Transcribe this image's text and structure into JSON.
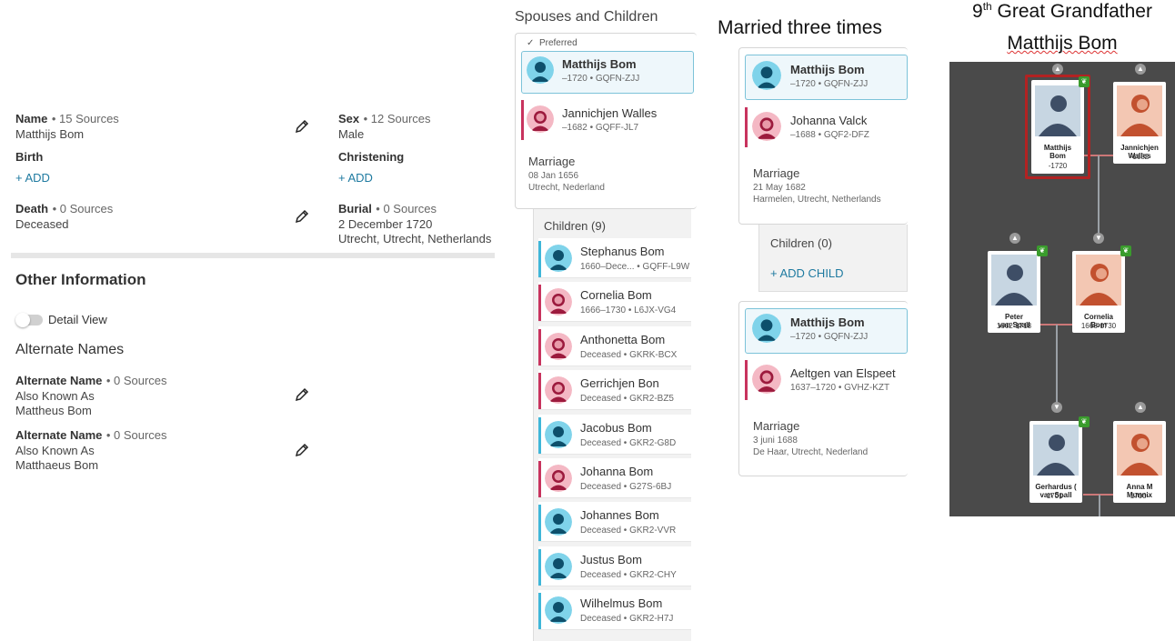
{
  "details": {
    "name": {
      "label": "Name",
      "sources": "• 15 Sources",
      "value": "Matthijs Bom"
    },
    "sex": {
      "label": "Sex",
      "sources": "• 12 Sources",
      "value": "Male"
    },
    "birth": {
      "label": "Birth",
      "add": "+  ADD"
    },
    "christening": {
      "label": "Christening",
      "add": "+  ADD"
    },
    "death": {
      "label": "Death",
      "sources": "• 0 Sources",
      "value": "Deceased"
    },
    "burial": {
      "label": "Burial",
      "sources": "• 0 Sources",
      "date": "2 December 1720",
      "place": "Utrecht, Utrecht, Netherlands"
    }
  },
  "other": {
    "heading": "Other Information",
    "detail_view": "Detail View",
    "alt_heading": "Alternate Names",
    "alt": [
      {
        "label": "Alternate Name",
        "sources": "• 0 Sources",
        "type": "Also Known As",
        "value": "Mattheus Bom"
      },
      {
        "label": "Alternate Name",
        "sources": "• 0 Sources",
        "type": "Also Known As",
        "value": "Matthaeus Bom"
      }
    ]
  },
  "family": {
    "title": "Spouses and Children",
    "preferred": "Preferred",
    "husband": {
      "name": "Matthijs Bom",
      "meta": "–1720 •  GQFN-ZJJ"
    },
    "wife": {
      "name": "Jannichjen Walles",
      "meta": "–1682 •  GQFF-JL7"
    },
    "marriage": {
      "label": "Marriage",
      "date": "08 Jan 1656",
      "place": "Utrecht, Nederland"
    },
    "children_header": "Children (9)",
    "children": [
      {
        "name": "Stephanus Bom",
        "meta": "1660–Dece...  •  GQFF-L9W",
        "sex": "m"
      },
      {
        "name": "Cornelia Bom",
        "meta": "1666–1730 •  L6JX-VG4",
        "sex": "f"
      },
      {
        "name": "Anthonetta Bom",
        "meta": "Deceased •  GKRK-BCX",
        "sex": "f"
      },
      {
        "name": "Gerrichjen Bon",
        "meta": "Deceased •  GKR2-BZ5",
        "sex": "f"
      },
      {
        "name": "Jacobus Bom",
        "meta": "Deceased •  GKR2-G8D",
        "sex": "m"
      },
      {
        "name": "Johanna Bom",
        "meta": "Deceased •  G27S-6BJ",
        "sex": "f"
      },
      {
        "name": "Johannes Bom",
        "meta": "Deceased •  GKR2-VVR",
        "sex": "m"
      },
      {
        "name": "Justus Bom",
        "meta": "Deceased •  GKR2-CHY",
        "sex": "m"
      },
      {
        "name": "Wilhelmus Bom",
        "meta": "Deceased •  GKR2-H7J",
        "sex": "m"
      }
    ]
  },
  "married": {
    "title": "Married three times",
    "m2": {
      "husband": {
        "name": "Matthijs Bom",
        "meta": "–1720 •  GQFN-ZJJ"
      },
      "wife": {
        "name": "Johanna Valck",
        "meta": "–1688 •  GQF2-DFZ"
      },
      "label": "Marriage",
      "date": "21 May 1682",
      "place": "Harmelen, Utrecht, Netherlands",
      "children_header": "Children (0)",
      "add_child": "+  ADD CHILD"
    },
    "m3": {
      "husband": {
        "name": "Matthijs Bom",
        "meta": "–1720 •  GQFN-ZJJ"
      },
      "wife": {
        "name": "Aeltgen van Elspeet",
        "meta": "1637–1720 •  GVHZ-KZT"
      },
      "label": "Marriage",
      "date": "3 juni 1688",
      "place": "De Haar, Utrecht, Nederland"
    }
  },
  "tree": {
    "title_sup": "th",
    "title_num": "9",
    "title_rest": " Great Grandfather",
    "title_name": "Matthijs Bom",
    "cards": [
      {
        "name1": "Matthijs",
        "name2": "Bom",
        "years": "-1720"
      },
      {
        "name1": "Jannichjen",
        "name2": "Walles",
        "years": "-1682"
      },
      {
        "name1": "Peter",
        "name2": "van Spall",
        "years": "1662-1718"
      },
      {
        "name1": "Cornelia",
        "name2": "Bom",
        "years": "1666-1730"
      },
      {
        "name1": "Gerhardus (",
        "name2": "van Spall",
        "years": "1701-"
      },
      {
        "name1": "Anna M",
        "name2": "Munnix",
        "years": "1700-"
      }
    ]
  },
  "colors": {
    "accent": "#1e7aa0",
    "male": "#3fb6d8",
    "female": "#c8335e",
    "tree_bg": "#4a4a4a",
    "selected": "#b22222"
  }
}
